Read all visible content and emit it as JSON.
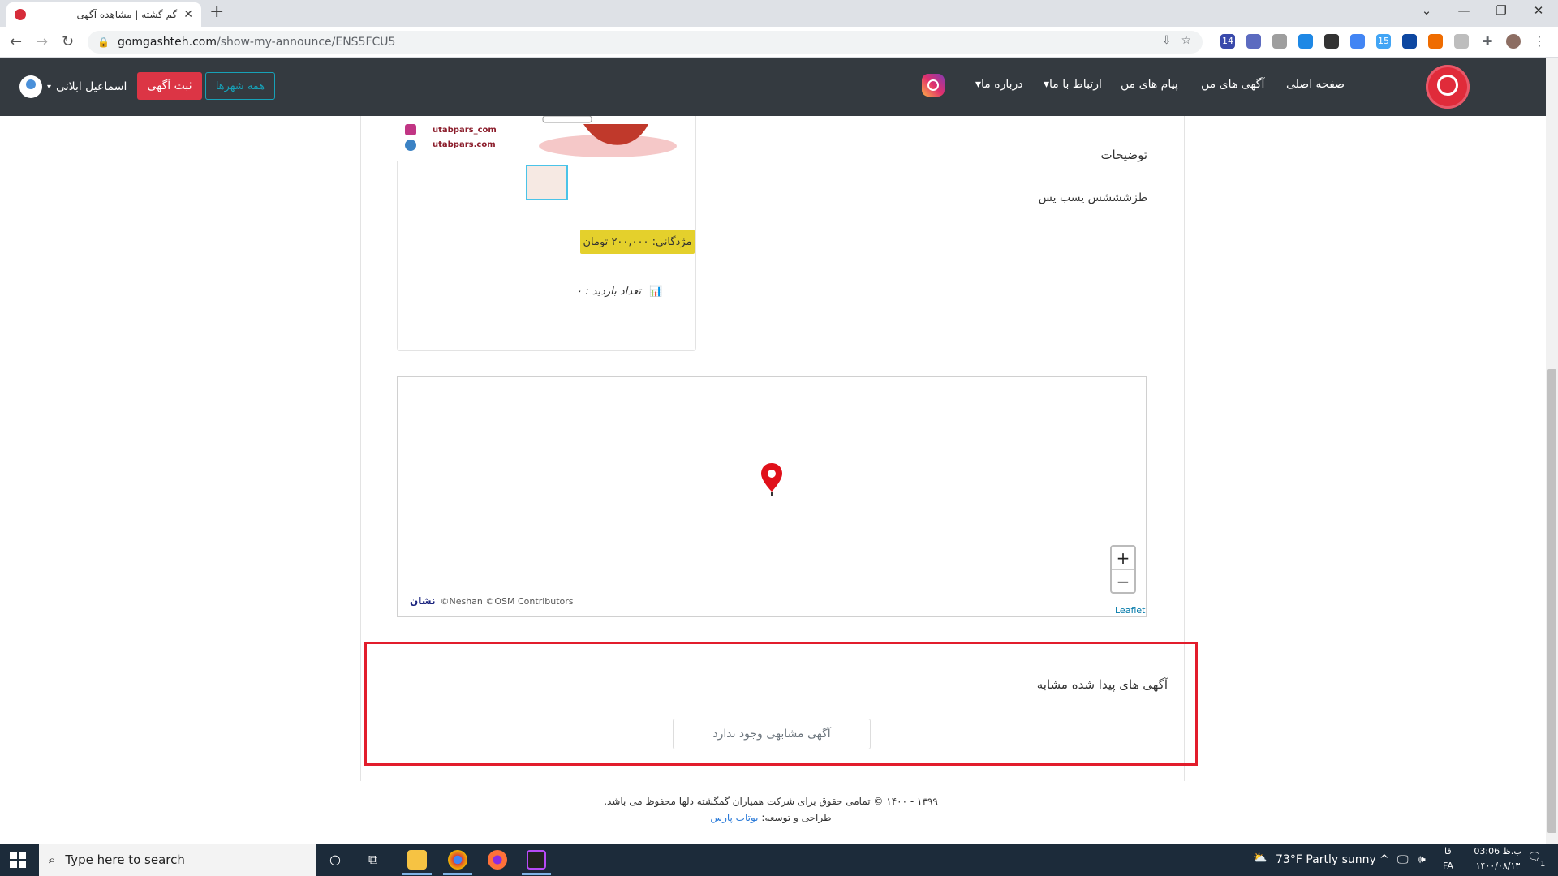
{
  "browser": {
    "tab_title": "گم گشته | مشاهده آگهی",
    "url_domain": "gomgashteh.com",
    "url_path": "/show-my-announce/ENS5FCU5",
    "new_tab": "+",
    "ext_badge_1": "14",
    "ext_badge_2": "15"
  },
  "header": {
    "nav": {
      "home": "صفحه اصلی",
      "my_ads": "آگهی های من",
      "my_messages": "پیام های من",
      "contact": "ارتباط با ما",
      "about": "درباره ما"
    },
    "all_cities": "همه شهرها",
    "post_ad": "ثبت آگهی",
    "user_name": "اسماعیل ابلانی"
  },
  "ad": {
    "image_line_1": "utabpars_com",
    "image_line_2": "utabpars.com",
    "reward": "مژدگانی: ۲۰۰,۰۰۰ تومان",
    "views_label": "تعداد بازدید : ۰",
    "description_title": "توضیحات",
    "description_text": "طزشششس یسب  یس"
  },
  "map": {
    "zoom_in": "+",
    "zoom_out": "−",
    "attribution": "©Neshan ©OSM Contributors",
    "neshan_logo": "نشان",
    "leaflet": "Leaflet"
  },
  "similar": {
    "title": "آگهی های پیدا شده مشابه",
    "empty": "آگهی مشابهی وجود ندارد"
  },
  "footer": {
    "copyright": "۱۳۹۹ - ۱۴۰۰ © تمامی حقوق برای شرکت همیاران گمگشته دلها محفوظ می باشد.",
    "design_label": "طراحی و توسعه:",
    "design_link": "یوتاب پارس"
  },
  "taskbar": {
    "search_placeholder": "Type here to search",
    "weather": "73°F  Partly sunny",
    "lang_top": "فا",
    "lang_bottom": "FA",
    "time": "03:06 ب.ظ",
    "date": "۱۴۰۰/۰۸/۱۳",
    "notif_count": "1"
  },
  "colors": {
    "header_bg": "#343a40",
    "accent_red": "#dc3545",
    "accent_teal": "#17a2b8",
    "reward_bg": "#e4d02c",
    "highlight_box": "#e21d2c"
  }
}
